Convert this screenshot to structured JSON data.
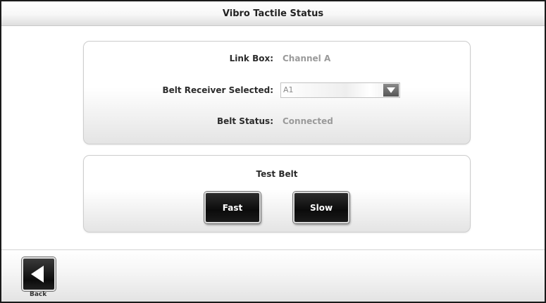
{
  "window": {
    "title": "Vibro Tactile Status"
  },
  "status": {
    "link_box": {
      "label": "Link Box:",
      "value": "Channel A"
    },
    "belt_receiver": {
      "label": "Belt Receiver Selected:",
      "value": "A1"
    },
    "belt_status": {
      "label": "Belt Status:",
      "value": "Connected"
    }
  },
  "test": {
    "title": "Test Belt",
    "fast_label": "Fast",
    "slow_label": "Slow"
  },
  "nav": {
    "back_label": "Back"
  },
  "icons": {
    "back": "left-triangle-icon",
    "dropdown": "chevron-down-icon"
  },
  "colors": {
    "button_bg": "#111111",
    "value_text": "#9a9a9a",
    "label_text": "#2b2b2b"
  }
}
